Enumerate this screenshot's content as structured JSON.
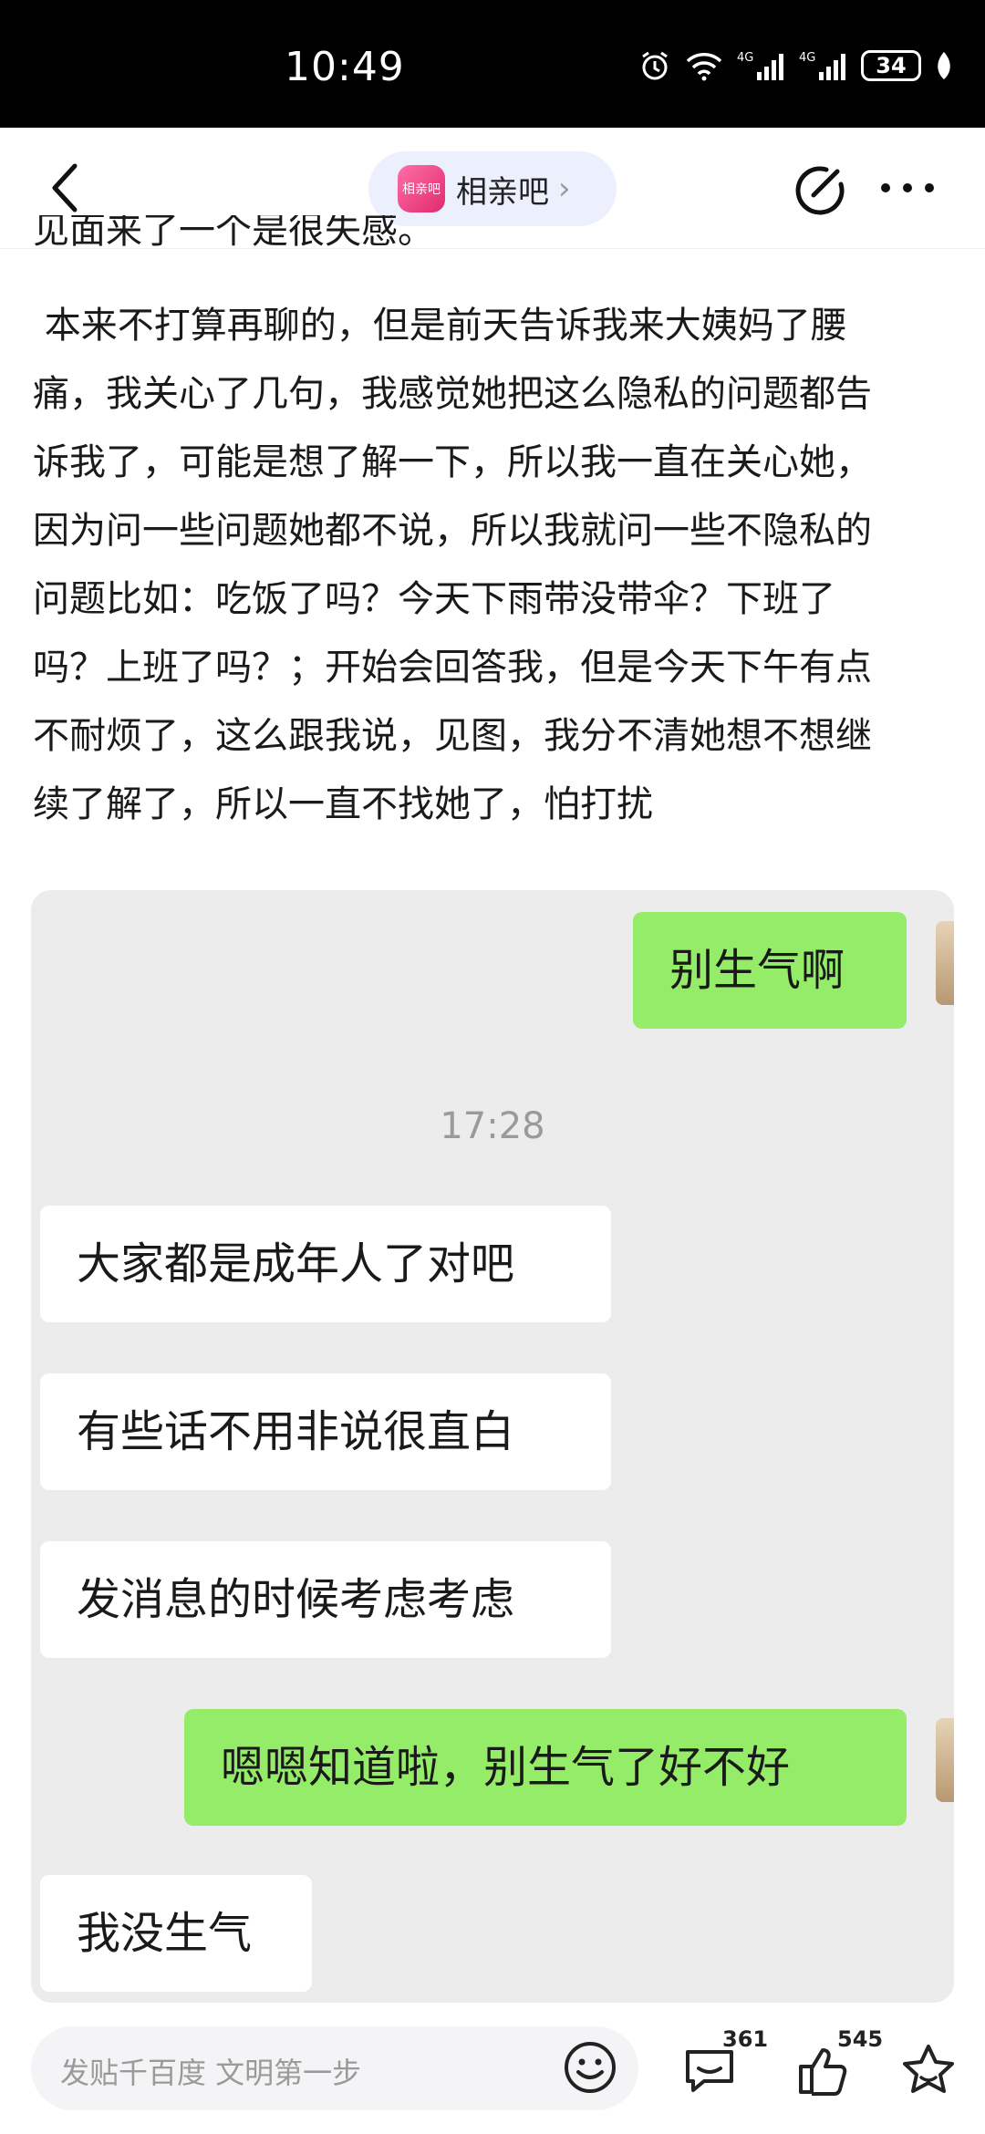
{
  "status_bar": {
    "time": "10:49",
    "battery": "34"
  },
  "nav": {
    "forum_name": "相亲吧",
    "forum_avatar_text": "相亲吧"
  },
  "post": {
    "clipped_line": "见面来了一个是很失感。",
    "paragraph_lines": [
      " 本来不打算再聊的，但是前天告诉我来大姨妈了腰",
      "痛，我关心了几句，我感觉她把这么隐私的问题都告",
      "诉我了，可能是想了解一下，所以我一直在关心她，",
      "因为问一些问题她都不说，所以我就问一些不隐私的",
      "问题比如：吃饭了吗？今天下雨带没带伞？下班了",
      "吗？上班了吗？；开始会回答我，但是今天下午有点",
      "不耐烦了，这么跟我说，见图，我分不清她想不想继",
      "续了解了，所以一直不找她了，怕打扰"
    ]
  },
  "chat": {
    "messages": [
      {
        "side": "me",
        "text": "别生气啊"
      },
      {
        "type": "time",
        "text": "17:28"
      },
      {
        "side": "other",
        "text": "大家都是成年人了对吧"
      },
      {
        "side": "other",
        "text": "有些话不用非说很直白"
      },
      {
        "side": "other",
        "text": "发消息的时候考虑考虑"
      },
      {
        "side": "me",
        "text": "嗯嗯知道啦，别生气了好不好"
      },
      {
        "side": "other",
        "text": "我没生气"
      }
    ]
  },
  "bottom": {
    "placeholder": "发贴千百度 文明第一步",
    "comment_count": "361",
    "like_count": "545"
  },
  "icons": [
    "alarm-icon",
    "wifi-icon",
    "signal-icon",
    "battery-icon",
    "leaf-icon",
    "back-icon",
    "edit-icon",
    "more-icon",
    "emoji-icon",
    "comment-icon",
    "like-icon",
    "star-icon"
  ]
}
